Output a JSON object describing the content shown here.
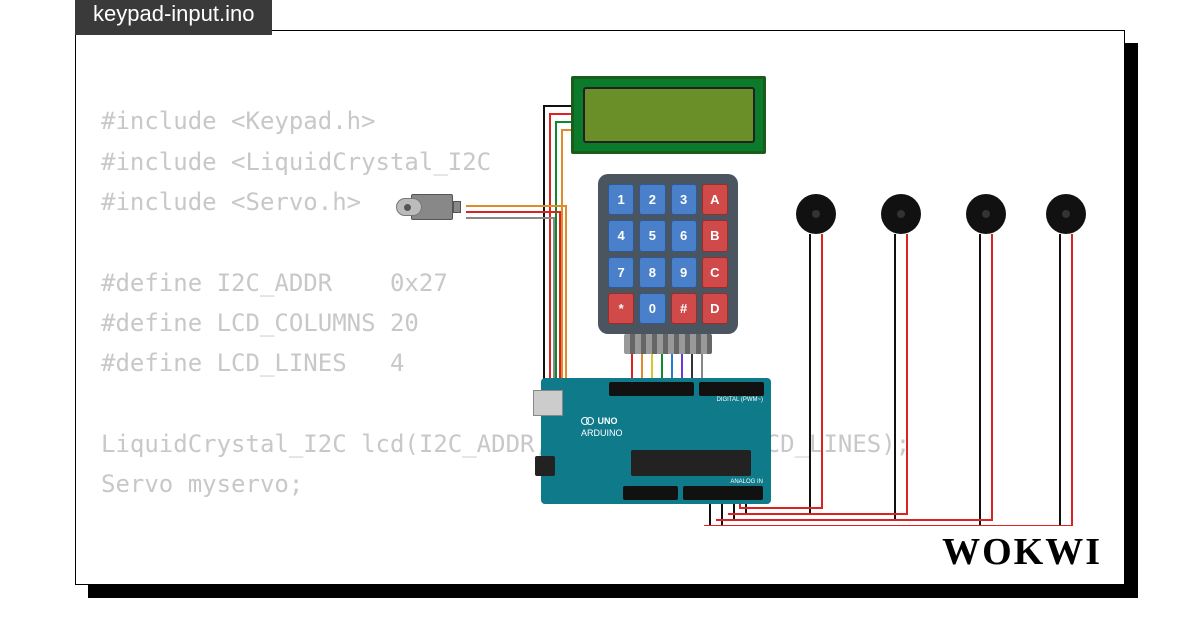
{
  "tab_title": "keypad-input.ino",
  "brand": "WOKWI",
  "code": {
    "l1": "#include <Keypad.h>",
    "l2": "#include <LiquidCrystal_I2C",
    "l3": "#include <Servo.h>",
    "l4": "",
    "l5": "#define I2C_ADDR    0x27",
    "l6": "#define LCD_COLUMNS 20",
    "l7": "#define LCD_LINES   4",
    "l8": "",
    "l9": "LiquidCrystal_I2C lcd(I2C_ADDR, LCD_COLUMNS, LCD_LINES);",
    "l10": "Servo myservo;"
  },
  "keypad": {
    "rows": [
      [
        "1",
        "2",
        "3",
        "A"
      ],
      [
        "4",
        "5",
        "6",
        "B"
      ],
      [
        "7",
        "8",
        "9",
        "C"
      ],
      [
        "*",
        "0",
        "#",
        "D"
      ]
    ],
    "letter_keys": [
      "A",
      "B",
      "C",
      "D",
      "*",
      "#"
    ]
  },
  "arduino": {
    "model": "UNO",
    "brand": "ARDUINO",
    "digital_label": "DIGITAL (PWM~)",
    "analog_label": "ANALOG IN"
  },
  "buzzer_count": 4,
  "wire_colors": {
    "power": "#d22",
    "ground": "#111",
    "signal_green": "#0a8a2a",
    "signal_orange": "#e08a2a",
    "signal_gray": "#888",
    "rainbow": [
      "#d22",
      "#e08a2a",
      "#d8c830",
      "#0a8a2a",
      "#2a7ad8",
      "#6a3ad8",
      "#333",
      "#888"
    ]
  }
}
